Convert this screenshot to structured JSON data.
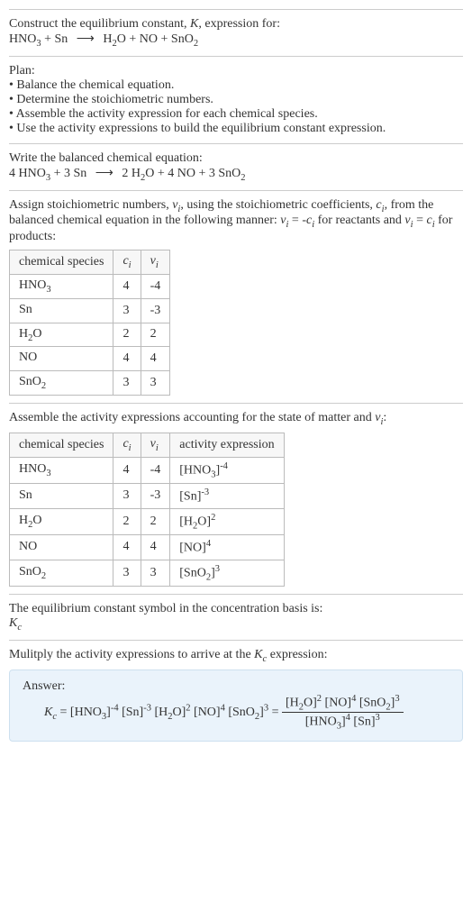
{
  "prompt": {
    "l1": "Construct the equilibrium constant, ",
    "Ksym": "K",
    "l1b": ", expression for:",
    "eq_lhs1": "HNO",
    "eq_lhs1_sub": "3",
    "plus": " + ",
    "eq_lhs2": "Sn",
    "arrow": "⟶",
    "eq_rhs1": "H",
    "eq_rhs1_sub": "2",
    "eq_rhs1b": "O",
    "eq_rhs2": "NO",
    "eq_rhs3": "SnO",
    "eq_rhs3_sub": "2"
  },
  "plan": {
    "title": "Plan:",
    "b1": "• Balance the chemical equation.",
    "b2": "• Determine the stoichiometric numbers.",
    "b3": "• Assemble the activity expression for each chemical species.",
    "b4": "• Use the activity expressions to build the equilibrium constant expression."
  },
  "balanced": {
    "lead": "Write the balanced chemical equation:",
    "c1": "4 HNO",
    "c1s": "3",
    "c2": " + 3 Sn ",
    "arrow": "⟶",
    "c3": " 2 H",
    "c3s": "2",
    "c3b": "O + 4 NO + 3 SnO",
    "c3s2": "2"
  },
  "stoich": {
    "lead1": "Assign stoichiometric numbers, ",
    "nu": "ν",
    "sub_i": "i",
    "lead2": ", using the stoichiometric coefficients, ",
    "c": "c",
    "lead3": ", from the balanced chemical equation in the following manner: ",
    "rel1a": "ν",
    "rel1b": " = -",
    "rel1c": "c",
    "lead4": " for reactants and ",
    "rel2a": "ν",
    "rel2b": " = ",
    "rel2c": "c",
    "lead5": " for products:",
    "h1": "chemical species",
    "h2": "c",
    "h3": "ν",
    "rows": [
      {
        "sp": "HNO",
        "sub": "3",
        "ci": "4",
        "vi": "-4"
      },
      {
        "sp": "Sn",
        "sub": "",
        "ci": "3",
        "vi": "-3"
      },
      {
        "sp": "H",
        "sub": "2",
        "spb": "O",
        "ci": "2",
        "vi": "2"
      },
      {
        "sp": "NO",
        "sub": "",
        "ci": "4",
        "vi": "4"
      },
      {
        "sp": "SnO",
        "sub": "2",
        "ci": "3",
        "vi": "3"
      }
    ]
  },
  "activity": {
    "lead": "Assemble the activity expressions accounting for the state of matter and ",
    "nu": "ν",
    "sub_i": "i",
    "colon": ":",
    "h1": "chemical species",
    "h2": "c",
    "h3": "ν",
    "h4": "activity expression",
    "rows": [
      {
        "sp": "HNO",
        "sub": "3",
        "ci": "4",
        "vi": "-4",
        "act": "[HNO",
        "acts": "3",
        "actb": "]",
        "exp": "-4"
      },
      {
        "sp": "Sn",
        "sub": "",
        "ci": "3",
        "vi": "-3",
        "act": "[Sn]",
        "acts": "",
        "actb": "",
        "exp": "-3"
      },
      {
        "sp": "H",
        "sub": "2",
        "spb": "O",
        "ci": "2",
        "vi": "2",
        "act": "[H",
        "acts": "2",
        "actb": "O]",
        "exp": "2"
      },
      {
        "sp": "NO",
        "sub": "",
        "ci": "4",
        "vi": "4",
        "act": "[NO]",
        "acts": "",
        "actb": "",
        "exp": "4"
      },
      {
        "sp": "SnO",
        "sub": "2",
        "ci": "3",
        "vi": "3",
        "act": "[SnO",
        "acts": "2",
        "actb": "]",
        "exp": "3"
      }
    ]
  },
  "symbol": {
    "lead": "The equilibrium constant symbol in the concentration basis is:",
    "K": "K",
    "c": "c"
  },
  "mult": {
    "lead": "Mulitply the activity expressions to arrive at the ",
    "K": "K",
    "c": "c",
    "tail": " expression:"
  },
  "answer": {
    "label": "Answer:",
    "Kc_K": "K",
    "Kc_c": "c",
    "eq": " = ",
    "t1": "[HNO",
    "t1s": "3",
    "t1b": "]",
    "e1": "-4",
    "t2": " [Sn]",
    "e2": "-3",
    "t3": " [H",
    "t3s": "2",
    "t3b": "O]",
    "e3": "2",
    "t4": " [NO]",
    "e4": "4",
    "t5": " [SnO",
    "t5s": "2",
    "t5b": "]",
    "e5": "3",
    "eq2": " = ",
    "num1": "[H",
    "num1s": "2",
    "num1b": "O]",
    "ne1": "2",
    "num2": " [NO]",
    "ne2": "4",
    "num3": " [SnO",
    "num3s": "2",
    "num3b": "]",
    "ne3": "3",
    "den1": "[HNO",
    "den1s": "3",
    "den1b": "]",
    "de1": "4",
    "den2": " [Sn]",
    "de2": "3"
  },
  "chart_data": {
    "type": "table",
    "tables": [
      {
        "headers": [
          "chemical species",
          "c_i",
          "ν_i"
        ],
        "rows": [
          [
            "HNO3",
            "4",
            "-4"
          ],
          [
            "Sn",
            "3",
            "-3"
          ],
          [
            "H2O",
            "2",
            "2"
          ],
          [
            "NO",
            "4",
            "4"
          ],
          [
            "SnO2",
            "3",
            "3"
          ]
        ]
      },
      {
        "headers": [
          "chemical species",
          "c_i",
          "ν_i",
          "activity expression"
        ],
        "rows": [
          [
            "HNO3",
            "4",
            "-4",
            "[HNO3]^-4"
          ],
          [
            "Sn",
            "3",
            "-3",
            "[Sn]^-3"
          ],
          [
            "H2O",
            "2",
            "2",
            "[H2O]^2"
          ],
          [
            "NO",
            "4",
            "4",
            "[NO]^4"
          ],
          [
            "SnO2",
            "3",
            "3",
            "[SnO2]^3"
          ]
        ]
      }
    ]
  }
}
